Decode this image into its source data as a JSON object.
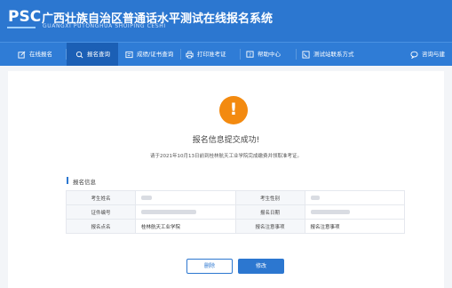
{
  "header": {
    "logo": "PSC",
    "title": "广西壮族自治区普通话水平测试在线报名系统",
    "subtitle": "GUANGXI PUTONGHUA SHUIPING CESHI"
  },
  "nav": {
    "items": [
      {
        "label": "在线报名",
        "icon": "edit-icon"
      },
      {
        "label": "报名查询",
        "icon": "search-icon"
      },
      {
        "label": "成绩/证书查询",
        "icon": "certificate-icon"
      },
      {
        "label": "打印准考证",
        "icon": "printer-icon"
      },
      {
        "label": "帮助中心",
        "icon": "help-icon"
      },
      {
        "label": "测试站联系方式",
        "icon": "phone-icon"
      },
      {
        "label": "咨询与建",
        "icon": "chat-icon"
      }
    ],
    "active_index": 1
  },
  "status": {
    "icon": "warning-icon",
    "message": "报名信息提交成功!",
    "note": "请于2021年10月13日前到桂林航天工业学院完成缴费并领取准考证。"
  },
  "section": {
    "title": "报名信息"
  },
  "info": {
    "rows": [
      {
        "l1": "考生姓名",
        "v1": "",
        "l2": "考生性别",
        "v2": ""
      },
      {
        "l1": "证件编号",
        "v1": "",
        "l2": "报名日期",
        "v2": ""
      },
      {
        "l1": "报名点名",
        "v1": "桂林航天工业学院",
        "l2": "报名注意事项",
        "v2": "报名注意事项"
      }
    ]
  },
  "buttons": {
    "delete": "删除",
    "edit": "修改"
  },
  "colors": {
    "primary": "#2c77d0",
    "warning": "#f38a10"
  }
}
